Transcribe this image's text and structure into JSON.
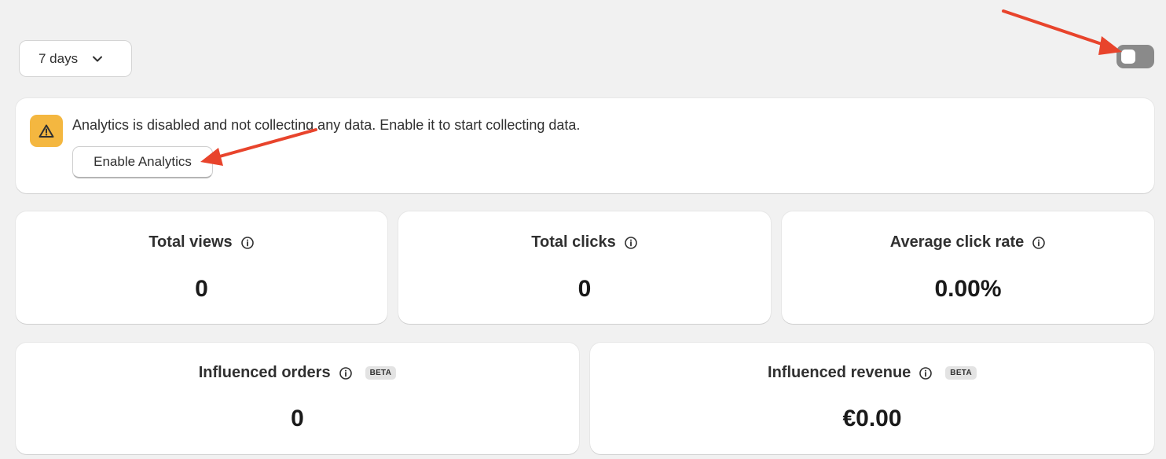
{
  "period": {
    "selected": "7 days",
    "icon": "chevron-down-icon"
  },
  "toggle": {
    "state": "off",
    "color": "#8a8a8a"
  },
  "banner": {
    "icon": "warning-icon",
    "icon_color": "#f4b740",
    "message": "Analytics is disabled and not collecting any data. Enable it to start collecting data.",
    "button_label": "Enable Analytics"
  },
  "metrics": [
    {
      "title": "Total views",
      "value": "0",
      "icon": "info-icon"
    },
    {
      "title": "Total clicks",
      "value": "0",
      "icon": "info-icon"
    },
    {
      "title": "Average click rate",
      "value": "0.00%",
      "icon": "info-icon"
    },
    {
      "title": "Influenced orders",
      "value": "0",
      "icon": "info-icon",
      "badge": "BETA"
    },
    {
      "title": "Influenced revenue",
      "value": "€0.00",
      "icon": "info-icon",
      "badge": "BETA"
    }
  ],
  "annotations": {
    "arrow_color": "#e8442c"
  }
}
